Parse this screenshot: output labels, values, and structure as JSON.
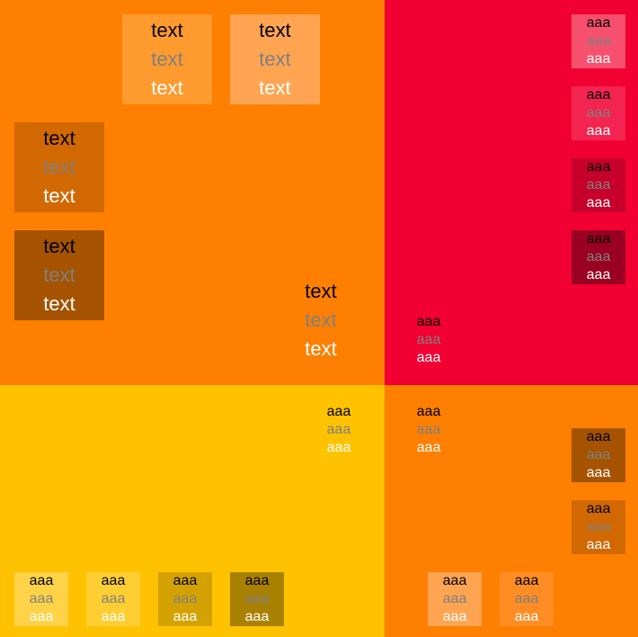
{
  "quadrants": {
    "top_left": "#ff7f00",
    "top_right": "#f20033",
    "bottom_left": "#ffc200",
    "bottom_right": "#ff7f00"
  },
  "big": {
    "line1": "text",
    "line2": "text",
    "line3": "text"
  },
  "small": {
    "line1": "aaa",
    "line2": "aaa",
    "line3": "aaa"
  },
  "swatch_colors": {
    "tl_light1": "#ff9a2e",
    "tl_light2": "#ffa552",
    "tl_dark1": "#d26800",
    "tl_dark2": "#a65300",
    "tr_light1": "#f7506f",
    "tr_light2": "#f42450",
    "tr_dark1": "#c6002a",
    "tr_dark2": "#9a0021",
    "bl_light1": "#ffd347",
    "bl_light2": "#ffce33",
    "bl_dark1": "#d4a200",
    "bl_dark2": "#a98100",
    "br_light1": "#ffa552",
    "br_light2": "#ff8d24",
    "br_dark1": "#a65300",
    "br_dark2": "#d26800"
  }
}
